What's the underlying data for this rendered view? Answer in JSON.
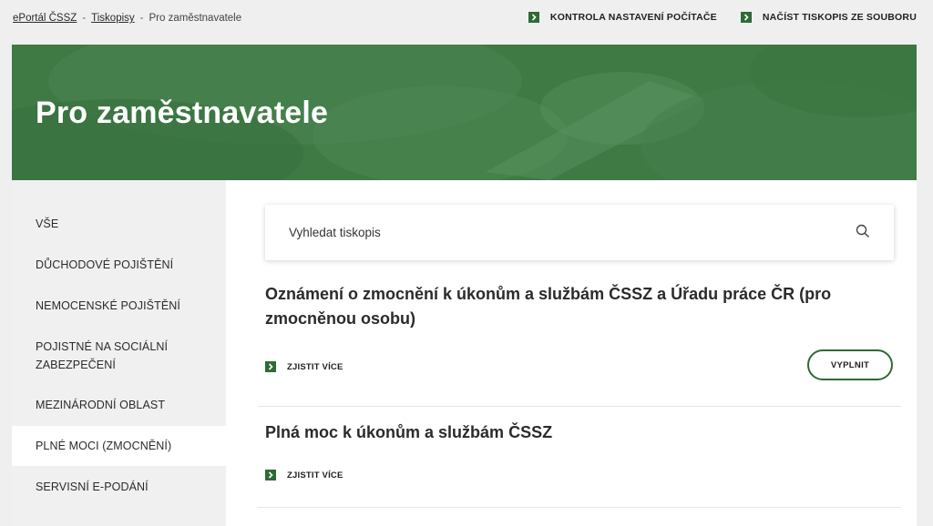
{
  "breadcrumb": {
    "items": [
      "ePortál ČSSZ",
      "Tiskopisy"
    ],
    "separator": "-",
    "current": "Pro zaměstnavatele"
  },
  "top_links": [
    {
      "label": "KONTROLA NASTAVENÍ POČÍTAČE",
      "icon": "chevron-right-icon"
    },
    {
      "label": "NAČÍST TISKOPIS ZE SOUBORU",
      "icon": "chevron-right-icon"
    }
  ],
  "hero": {
    "title": "Pro zaměstnavatele"
  },
  "sidebar": {
    "items": [
      {
        "label": "VŠE"
      },
      {
        "label": "DŮCHODOVÉ POJIŠTĚNÍ"
      },
      {
        "label": "NEMOCENSKÉ POJIŠTĚNÍ"
      },
      {
        "label": "POJISTNÉ NA SOCIÁLNÍ ZABEZPEČENÍ"
      },
      {
        "label": "MEZINÁRODNÍ OBLAST"
      },
      {
        "label": "PLNÉ MOCI (ZMOCNĚNÍ)",
        "active": true
      },
      {
        "label": "SERVISNÍ E-PODÁNÍ"
      }
    ]
  },
  "search": {
    "placeholder": "Vyhledat tiskopis",
    "icon": "search-icon"
  },
  "forms": [
    {
      "title": "Oznámení o zmocnění k úkonům a službám ČSSZ a Úřadu práce ČR (pro zmocněnou osobu)",
      "more_label": "ZJISTIT VÍCE",
      "fill_label": "VYPLNIT"
    },
    {
      "title": "Plná moc k úkonům a službám ČSSZ",
      "more_label": "ZJISTIT VÍCE"
    }
  ],
  "colors": {
    "accent": "#2e6a35",
    "hero": "#3f7a45",
    "page_bg": "#efefef",
    "sidebar_bg": "#f0f0f0",
    "content_bg": "#ffffff"
  }
}
